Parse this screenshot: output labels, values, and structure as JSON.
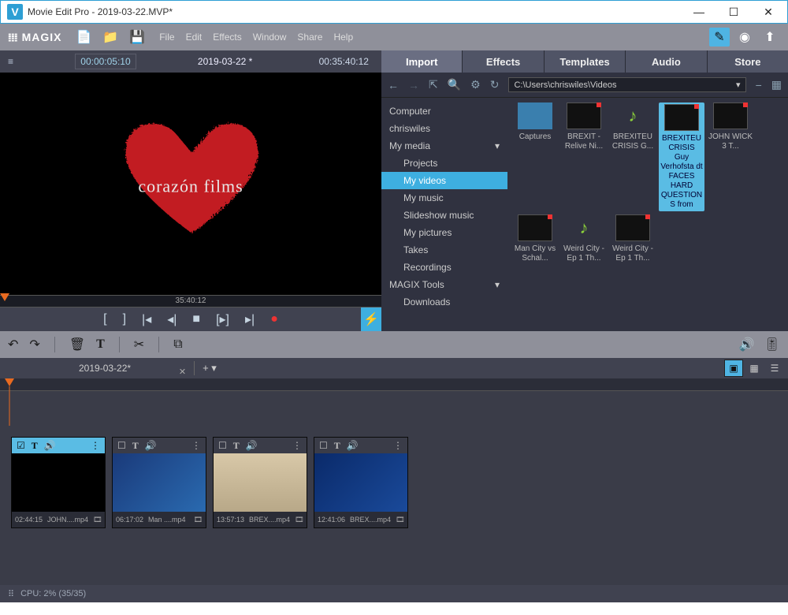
{
  "window": {
    "title": "Movie Edit Pro - 2019-03-22.MVP*"
  },
  "brand": "MAGIX",
  "menu": [
    "File",
    "Edit",
    "Effects",
    "Window",
    "Share",
    "Help"
  ],
  "preview": {
    "left_tc": "00:00:05:10",
    "title": "2019-03-22 *",
    "right_tc": "00:35:40:12",
    "ruler_label": "35:40:12",
    "logo_text": "corazón films"
  },
  "media_tabs": [
    "Import",
    "Effects",
    "Templates",
    "Audio",
    "Store"
  ],
  "media_path": "C:\\Users\\chriswiles\\Videos",
  "tree": {
    "computer": "Computer",
    "user": "chriswiles",
    "mymedia": "My media",
    "children": [
      "Projects",
      "My videos",
      "My music",
      "Slideshow music",
      "My pictures",
      "Takes",
      "Recordings"
    ],
    "tools": "MAGIX Tools",
    "tools_children": [
      "Downloads"
    ]
  },
  "media_items": [
    {
      "label": "Captures",
      "kind": "folder"
    },
    {
      "label": "BREXIT - Relive Ni...",
      "kind": "video"
    },
    {
      "label": "BREXITEU CRISIS G...",
      "kind": "music"
    },
    {
      "label": "BREXITEU CRISIS Guy Verhofsta dt FACES HARD QUESTION S from",
      "kind": "video",
      "selected": true
    },
    {
      "label": "JOHN WICK 3 T...",
      "kind": "video"
    },
    {
      "label": "Man City vs Schal...",
      "kind": "video"
    },
    {
      "label": "Weird City - Ep 1 Th...",
      "kind": "music"
    },
    {
      "label": "Weird City - Ep 1 Th...",
      "kind": "video"
    }
  ],
  "doc_tab": "2019-03-22*",
  "clips": [
    {
      "tc": "02:44:15",
      "name": "JOHN....mp4",
      "sel": true
    },
    {
      "tc": "06:17:02",
      "name": "Man ....mp4"
    },
    {
      "tc": "13:57:13",
      "name": "BREX....mp4"
    },
    {
      "tc": "12:41:06",
      "name": "BREX....mp4"
    }
  ],
  "status": {
    "cpu": "CPU: 2% (35/35)"
  }
}
